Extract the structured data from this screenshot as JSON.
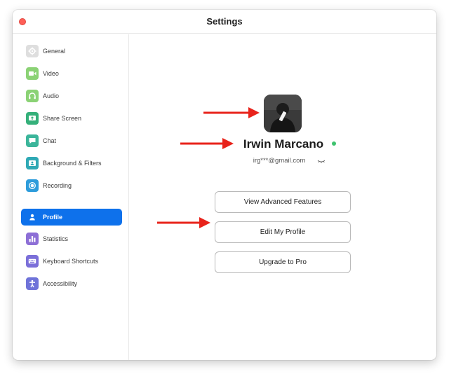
{
  "window": {
    "title": "Settings"
  },
  "sidebar": {
    "items": [
      {
        "label": "General",
        "icon": "gear-icon",
        "color": "#d9d9d9",
        "active": false
      },
      {
        "label": "Video",
        "icon": "video-camera-icon",
        "color": "#8bd275",
        "active": false
      },
      {
        "label": "Audio",
        "icon": "headphones-icon",
        "color": "#8bd275",
        "active": false
      },
      {
        "label": "Share Screen",
        "icon": "share-screen-icon",
        "color": "#35b07a",
        "active": false
      },
      {
        "label": "Chat",
        "icon": "chat-bubble-icon",
        "color": "#3bb59a",
        "active": false
      },
      {
        "label": "Background & Filters",
        "icon": "background-image-icon",
        "color": "#2fa9b5",
        "active": false
      },
      {
        "label": "Recording",
        "icon": "record-icon",
        "color": "#2d9cdb",
        "active": false
      },
      {
        "label": "Profile",
        "icon": "person-icon",
        "color": "#0e71eb",
        "active": true
      },
      {
        "label": "Statistics",
        "icon": "bar-chart-icon",
        "color": "#8d6fd6",
        "active": false
      },
      {
        "label": "Keyboard Shortcuts",
        "icon": "keyboard-icon",
        "color": "#7b6fd9",
        "active": false
      },
      {
        "label": "Accessibility",
        "icon": "accessibility-icon",
        "color": "#6f73d9",
        "active": false
      }
    ]
  },
  "profile": {
    "name": "Irwin Marcano",
    "email": "irg***@gmail.com",
    "status_color": "#3ec26e",
    "buttons": {
      "advanced": "View Advanced Features",
      "edit": "Edit My Profile",
      "upgrade": "Upgrade to Pro"
    }
  },
  "annotation_color": "#e8231b"
}
